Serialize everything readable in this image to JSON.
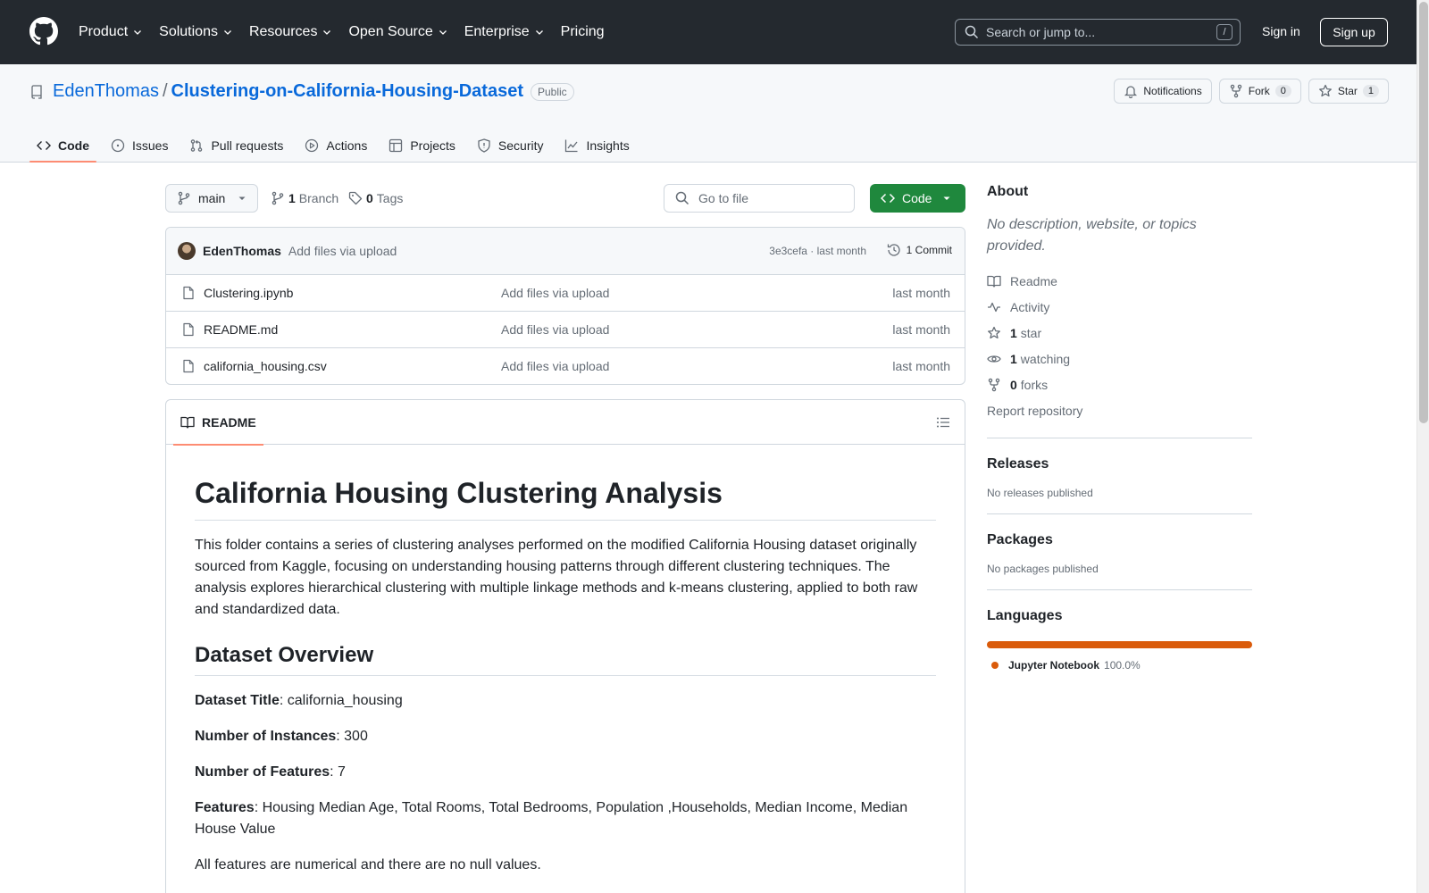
{
  "header": {
    "nav": [
      "Product",
      "Solutions",
      "Resources",
      "Open Source",
      "Enterprise",
      "Pricing"
    ],
    "search_placeholder": "Search or jump to...",
    "search_shortcut": "/",
    "sign_in": "Sign in",
    "sign_up": "Sign up"
  },
  "repo": {
    "owner": "EdenThomas",
    "separator": "/",
    "name": "Clustering-on-California-Housing-Dataset",
    "visibility": "Public",
    "notifications_label": "Notifications",
    "fork_label": "Fork",
    "fork_count": "0",
    "star_label": "Star",
    "star_count": "1",
    "tabs": [
      "Code",
      "Issues",
      "Pull requests",
      "Actions",
      "Projects",
      "Security",
      "Insights"
    ]
  },
  "toolbar": {
    "branch": "main",
    "branch_count": "1",
    "branch_label": "Branch",
    "tag_count": "0",
    "tag_label": "Tags",
    "goto_placeholder": "Go to file",
    "code_button": "Code"
  },
  "commit": {
    "author": "EdenThomas",
    "message": "Add files via upload",
    "meta": "3e3cefa · last month",
    "count_label": "1 Commit"
  },
  "files": [
    {
      "name": "Clustering.ipynb",
      "message": "Add files via upload",
      "date": "last month"
    },
    {
      "name": "README.md",
      "message": "Add files via upload",
      "date": "last month"
    },
    {
      "name": "california_housing.csv",
      "message": "Add files via upload",
      "date": "last month"
    }
  ],
  "readme": {
    "tab_label": "README",
    "title": "California Housing Clustering Analysis",
    "intro": "This folder contains a series of clustering analyses performed on the modified California Housing dataset originally sourced from Kaggle, focusing on understanding housing patterns through different clustering techniques. The analysis explores hierarchical clustering with multiple linkage methods and k-means clustering, applied to both raw and standardized data.",
    "overview_heading": "Dataset Overview",
    "dataset_title_label": "Dataset Title",
    "dataset_title_value": ": california_housing",
    "instances_label": "Number of Instances",
    "instances_value": ": 300",
    "features_count_label": "Number of Features",
    "features_count_value": ": 7",
    "features_label": "Features",
    "features_value": ": Housing Median Age, Total Rooms, Total Bedrooms, Population ,Households, Median Income, Median House Value",
    "note": "All features are numerical and there are no null values."
  },
  "sidebar": {
    "about_heading": "About",
    "description": "No description, website, or topics provided.",
    "readme_link": "Readme",
    "activity_link": "Activity",
    "stars_count": "1",
    "stars_label": "star",
    "watching_count": "1",
    "watching_label": "watching",
    "forks_count": "0",
    "forks_label": "forks",
    "report": "Report repository",
    "releases_heading": "Releases",
    "releases_text": "No releases published",
    "packages_heading": "Packages",
    "packages_text": "No packages published",
    "languages_heading": "Languages",
    "language_name": "Jupyter Notebook",
    "language_pct": "100.0%",
    "language_color": "#da5b0b"
  },
  "colors": {
    "header_bg": "#24292f",
    "link": "#0969da",
    "primary_button": "#1f883d",
    "active_tab_underline": "#fd8c73"
  }
}
